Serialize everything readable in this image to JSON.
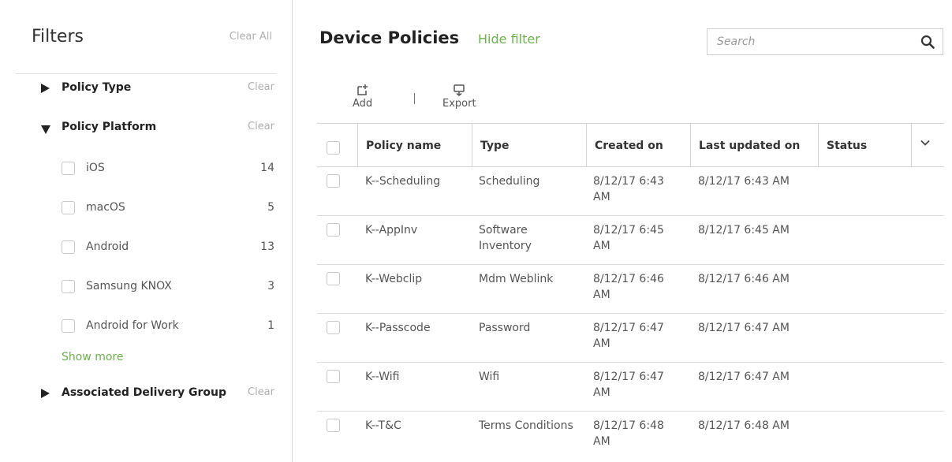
{
  "sidebar": {
    "title": "Filters",
    "clear_all": "Clear All",
    "sections": [
      {
        "label": "Policy Type",
        "clear": "Clear"
      },
      {
        "label": "Policy Platform",
        "clear": "Clear"
      },
      {
        "label": "Associated Delivery Group",
        "clear": "Clear"
      }
    ],
    "platform_options": [
      {
        "label": "iOS",
        "count": "14"
      },
      {
        "label": "macOS",
        "count": "5"
      },
      {
        "label": "Android",
        "count": "13"
      },
      {
        "label": "Samsung KNOX",
        "count": "3"
      },
      {
        "label": "Android for Work",
        "count": "1"
      }
    ],
    "show_more": "Show more"
  },
  "header": {
    "title": "Device Policies",
    "hide_filter": "Hide filter",
    "search_placeholder": "Search"
  },
  "toolbar": {
    "add_label": "Add",
    "export_label": "Export"
  },
  "table": {
    "columns": [
      "Policy name",
      "Type",
      "Created on",
      "Last updated on",
      "Status"
    ],
    "rows": [
      {
        "name": "K--Scheduling",
        "type": "Scheduling",
        "created": "8/12/17 6:43 AM",
        "updated": "8/12/17 6:43 AM",
        "status": ""
      },
      {
        "name": "K--AppInv",
        "type": "Software Inventory",
        "created": "8/12/17 6:45 AM",
        "updated": "8/12/17 6:45 AM",
        "status": ""
      },
      {
        "name": "K--Webclip",
        "type": "Mdm Weblink",
        "created": "8/12/17 6:46 AM",
        "updated": "8/12/17 6:46 AM",
        "status": ""
      },
      {
        "name": "K--Passcode",
        "type": "Password",
        "created": "8/12/17 6:47 AM",
        "updated": "8/12/17 6:47 AM",
        "status": ""
      },
      {
        "name": "K--Wifi",
        "type": "Wifi",
        "created": "8/12/17 6:47 AM",
        "updated": "8/12/17 6:47 AM",
        "status": ""
      },
      {
        "name": "K--T&C",
        "type": "Terms Conditions",
        "created": "8/12/17 6:48 AM",
        "updated": "8/12/17 6:48 AM",
        "status": ""
      }
    ]
  },
  "colors": {
    "accent_green": "#6bb24a",
    "muted_text": "#b0b0b0",
    "border": "#d6d6d6"
  }
}
